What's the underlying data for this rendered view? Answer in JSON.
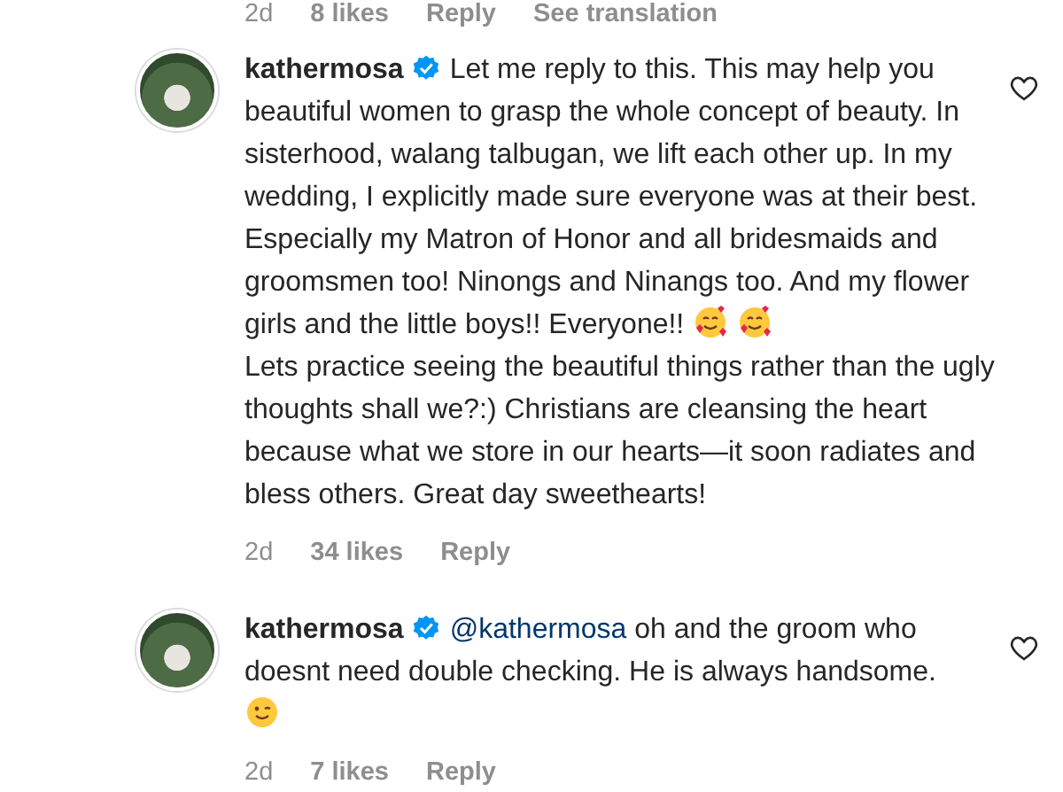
{
  "top_meta": {
    "time": "2d",
    "likes": "8 likes",
    "reply": "Reply",
    "translate": "See translation"
  },
  "comments": [
    {
      "username": "kathermosa",
      "verified": true,
      "liked": false,
      "paragraphs": [
        [
          {
            "kind": "text",
            "text": "Let me reply to this. This may help you beautiful women to grasp the whole concept of beauty. In sisterhood, walang talbugan, we lift each other up. In my wedding, I explicitly made sure everyone was at their best. Especially my Matron of Honor and all bridesmaids and groomsmen too! Ninongs and Ninangs too. And my flower girls and the little boys!! Everyone!! "
          },
          {
            "kind": "hearts"
          },
          {
            "kind": "hearts"
          }
        ],
        [
          {
            "kind": "text",
            "text": "Lets practice seeing the beautiful things rather than the ugly thoughts shall we?:) Christians are cleansing the heart because what we store in our hearts—it soon radiates and bless others. Great day sweethearts!"
          }
        ]
      ],
      "time": "2d",
      "likes": "34 likes",
      "reply": "Reply"
    },
    {
      "username": "kathermosa",
      "verified": true,
      "liked": false,
      "paragraphs": [
        [
          {
            "kind": "mention",
            "text": "@kathermosa"
          },
          {
            "kind": "text",
            "text": " oh and the groom who doesnt need double checking. He is always handsome."
          }
        ],
        [
          {
            "kind": "wink"
          }
        ]
      ],
      "time": "2d",
      "likes": "7 likes",
      "reply": "Reply"
    }
  ]
}
